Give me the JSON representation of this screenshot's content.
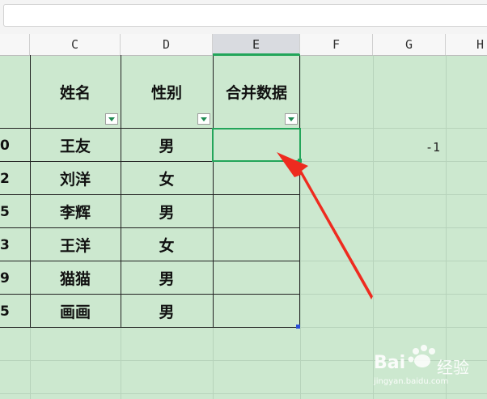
{
  "columns": [
    "C",
    "D",
    "E",
    "F",
    "G",
    "H"
  ],
  "table": {
    "headers": [
      "姓名",
      "性别",
      "合并数据"
    ],
    "row_fragments": [
      "0",
      "2",
      "5",
      "3",
      "9",
      "5"
    ],
    "rows": [
      {
        "name": "王友",
        "gender": "男",
        "merged": ""
      },
      {
        "name": "刘洋",
        "gender": "女",
        "merged": ""
      },
      {
        "name": "李辉",
        "gender": "男",
        "merged": ""
      },
      {
        "name": "王洋",
        "gender": "女",
        "merged": ""
      },
      {
        "name": "猫猫",
        "gender": "男",
        "merged": ""
      },
      {
        "name": "画画",
        "gender": "男",
        "merged": ""
      }
    ]
  },
  "g_cell_value": "-1",
  "watermark": {
    "brand": "Bai",
    "brand2": "经验",
    "url": "jingyan.baidu.com"
  },
  "colors": {
    "sheet_bg": "#cce8cf",
    "selection": "#23a55a",
    "arrow": "#ee2b1f",
    "filter_arrow": "#1e8a52"
  }
}
